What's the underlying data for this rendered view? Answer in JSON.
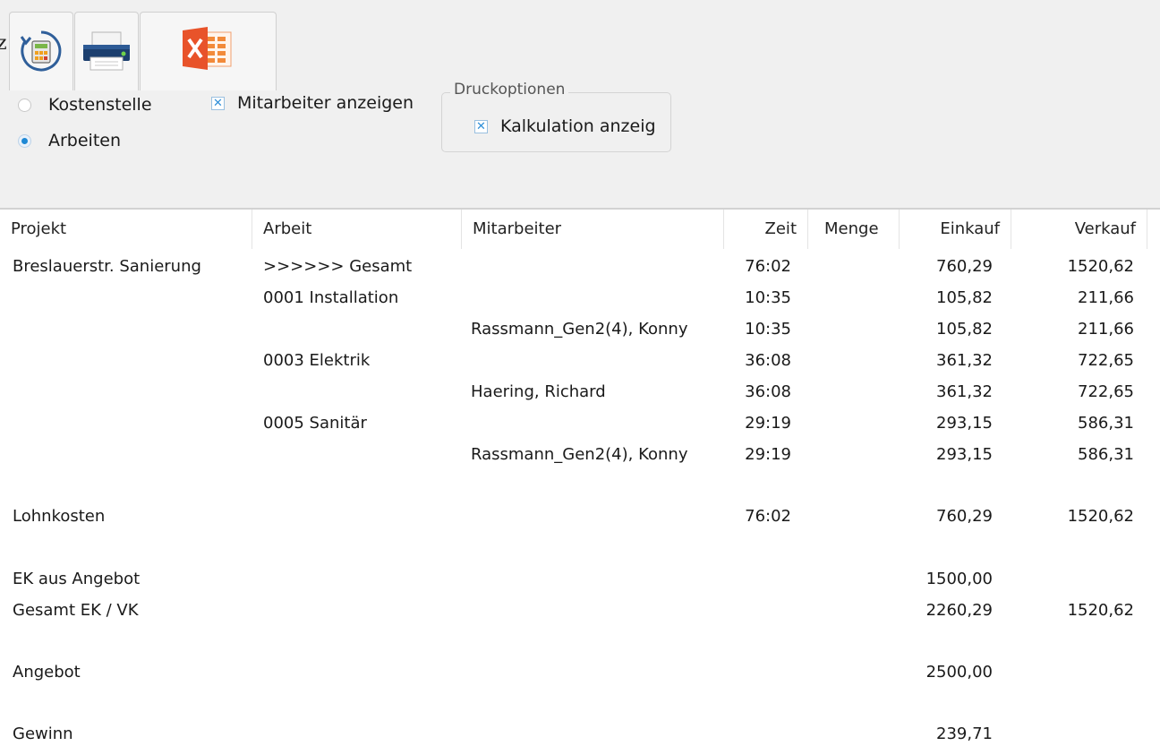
{
  "toolbar": {
    "edge_glyph": "z",
    "buttons": [
      {
        "name": "recalculate",
        "icon": "calculator-refresh-icon"
      },
      {
        "name": "print",
        "icon": "printer-icon"
      },
      {
        "name": "excel-export",
        "icon": "excel-icon"
      }
    ]
  },
  "options": {
    "kostenstelle_label": "Kostenstelle",
    "arbeiten_label": "Arbeiten",
    "selected_mode": "Arbeiten",
    "mitarbeiter_label": "Mitarbeiter anzeigen",
    "mitarbeiter_checked": true,
    "druckoptionen_legend": "Druckoptionen",
    "kalkulation_label": "Kalkulation anzeig",
    "kalkulation_checked": true,
    "check_glyph": "✕"
  },
  "table": {
    "headers": {
      "projekt": "Projekt",
      "arbeit": "Arbeit",
      "mitarbeiter": "Mitarbeiter",
      "zeit": "Zeit",
      "menge": "Menge",
      "einkauf": "Einkauf",
      "verkauf": "Verkauf"
    },
    "rows": [
      {
        "projekt": "Breslauerstr. Sanierung",
        "arbeit": ">>>>>> Gesamt",
        "mitarbeiter": "",
        "zeit": "76:02",
        "menge": "",
        "einkauf": "760,29",
        "verkauf": "1520,62"
      },
      {
        "projekt": "",
        "arbeit": "0001 Installation",
        "mitarbeiter": "",
        "zeit": "10:35",
        "menge": "",
        "einkauf": "105,82",
        "verkauf": "211,66"
      },
      {
        "projekt": "",
        "arbeit": "",
        "mitarbeiter": "Rassmann_Gen2(4), Konny",
        "zeit": "10:35",
        "menge": "",
        "einkauf": "105,82",
        "verkauf": "211,66"
      },
      {
        "projekt": "",
        "arbeit": "0003 Elektrik",
        "mitarbeiter": "",
        "zeit": "36:08",
        "menge": "",
        "einkauf": "361,32",
        "verkauf": "722,65"
      },
      {
        "projekt": "",
        "arbeit": "",
        "mitarbeiter": "Haering, Richard",
        "zeit": "36:08",
        "menge": "",
        "einkauf": "361,32",
        "verkauf": "722,65"
      },
      {
        "projekt": "",
        "arbeit": "0005 Sanitär",
        "mitarbeiter": "",
        "zeit": "29:19",
        "menge": "",
        "einkauf": "293,15",
        "verkauf": "586,31"
      },
      {
        "projekt": "",
        "arbeit": "",
        "mitarbeiter": "Rassmann_Gen2(4), Konny",
        "zeit": "29:19",
        "menge": "",
        "einkauf": "293,15",
        "verkauf": "586,31"
      },
      {
        "projekt": "Lohnkosten",
        "arbeit": "",
        "mitarbeiter": "",
        "zeit": "76:02",
        "menge": "",
        "einkauf": "760,29",
        "verkauf": "1520,62"
      },
      {
        "projekt": "EK aus Angebot",
        "arbeit": "",
        "mitarbeiter": "",
        "zeit": "",
        "menge": "",
        "einkauf": "1500,00",
        "verkauf": ""
      },
      {
        "projekt": "Gesamt EK / VK",
        "arbeit": "",
        "mitarbeiter": "",
        "zeit": "",
        "menge": "",
        "einkauf": "2260,29",
        "verkauf": "1520,62"
      },
      {
        "projekt": "Angebot",
        "arbeit": "",
        "mitarbeiter": "",
        "zeit": "",
        "menge": "",
        "einkauf": "2500,00",
        "verkauf": ""
      },
      {
        "projekt": "Gewinn",
        "arbeit": "",
        "mitarbeiter": "",
        "zeit": "",
        "menge": "",
        "einkauf": "239,71",
        "verkauf": ""
      }
    ]
  },
  "colors": {
    "toolbar_bg": "#f0f0f0",
    "accent": "#1e88d4",
    "excel_orange": "#e8532a"
  }
}
